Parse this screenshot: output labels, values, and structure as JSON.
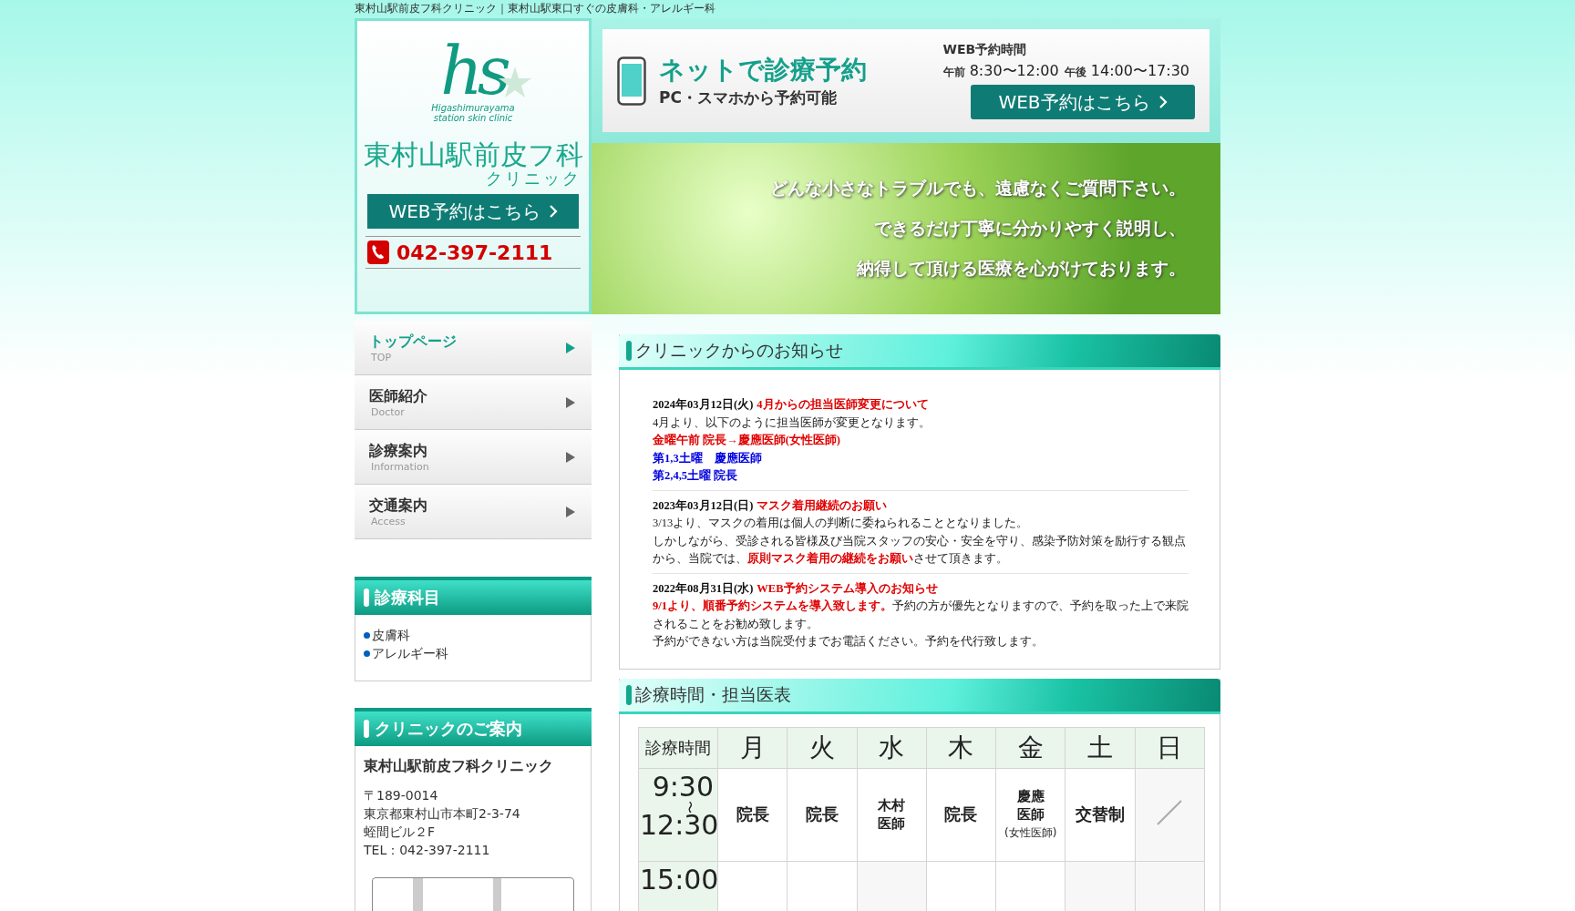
{
  "top_caption": "東村山駅前皮フ科クリニック｜東村山駅東口すぐの皮膚科・アレルギー科",
  "logo": {
    "monogram": "hs",
    "roman_line1": "Higashimurayama",
    "roman_line2": "station skin clinic",
    "name": "東村山駅前皮フ科",
    "name_sub": "クリニック",
    "web_button": "WEB予約はこちら",
    "phone": "042-397-2111"
  },
  "reservation": {
    "headline": "ネットで診療予約",
    "subline": "PC・スマホから予約可能",
    "hours_title": "WEB予約時間",
    "am_label": "午前",
    "am_hours": "8:30〜12:00",
    "pm_label": "午後",
    "pm_hours": "14:00〜17:30",
    "button": "WEB予約はこちら"
  },
  "banner_lines": [
    "どんな小さなトラブルでも、遠慮なくご質問下さい。",
    "できるだけ丁寧に分かりやすく説明し、",
    "納得して頂ける医療を心がけております。"
  ],
  "nav": [
    {
      "label": "トップページ",
      "sub": "TOP",
      "selected": true
    },
    {
      "label": "医師紹介",
      "sub": "Doctor",
      "selected": false
    },
    {
      "label": "診療案内",
      "sub": "Information",
      "selected": false
    },
    {
      "label": "交通案内",
      "sub": "Access",
      "selected": false
    }
  ],
  "departments": {
    "title": "診療科目",
    "items": [
      "皮膚科",
      "アレルギー科"
    ]
  },
  "clinic_info": {
    "title": "クリニックのご案内",
    "name": "東村山駅前皮フ科クリニック",
    "address_lines": [
      "〒189-0014",
      "東京都東村山市本町2-3-74",
      "蛭間ビル２F",
      "TEL：042-397-2111"
    ]
  },
  "news": {
    "title": "クリニックからのお知らせ",
    "items": [
      {
        "date": "2024年03月12日(火)",
        "title": "4月からの担当医師変更について",
        "lines": [
          {
            "kind": "plain",
            "text": "4月より、以下のように担当医師が変更となります。"
          },
          {
            "kind": "red",
            "text": "金曜午前 院長→慶應医師(女性医師)"
          },
          {
            "kind": "blue",
            "text": "第1,3土曜　慶應医師"
          },
          {
            "kind": "blue",
            "text": "第2,4,5土曜 院長"
          }
        ]
      },
      {
        "date": "2023年03月12日(日)",
        "title": "マスク着用継続のお願い",
        "lines": [
          {
            "kind": "plain",
            "text": "3/13より、マスクの着用は個人の判断に委ねられることとなりました。"
          },
          {
            "kind": "plain",
            "text": "しかしながら、受診される皆様及び当院スタッフの安心・安全を守り、感染予防対策を励行する観点から、当院では、**原則マスク着用の継続をお願い**させて頂きます。"
          }
        ]
      },
      {
        "date": "2022年08月31日(水)",
        "title": "WEB予約システム導入のお知らせ",
        "lines": [
          {
            "kind": "plain",
            "text": "**9/1より、順番予約システムを導入致します。**予約の方が優先となりますので、予約を取った上で来院されることをお勧め致します。"
          },
          {
            "kind": "plain",
            "text": "予約ができない方は当院受付までお電話ください。予約を代行致します。"
          }
        ]
      }
    ]
  },
  "schedule": {
    "title": "診療時間・担当医表",
    "corner": "診療時間",
    "days": [
      "月",
      "火",
      "水",
      "木",
      "金",
      "土",
      "日"
    ],
    "rows": [
      {
        "time_start": "9:30",
        "separator": "〜",
        "time_end": "12:30",
        "cells": [
          {
            "kind": "doctor",
            "lines": [
              "院長"
            ]
          },
          {
            "kind": "doctor",
            "lines": [
              "院長"
            ]
          },
          {
            "kind": "small",
            "lines": [
              "木村",
              "医師"
            ]
          },
          {
            "kind": "doctor",
            "lines": [
              "院長"
            ]
          },
          {
            "kind": "small",
            "lines": [
              "慶應",
              "医師",
              "(女性医師)"
            ]
          },
          {
            "kind": "doctor",
            "lines": [
              "交替制"
            ]
          },
          {
            "kind": "closed"
          }
        ]
      },
      {
        "time_start": "15:00",
        "cells": [
          {
            "kind": "blank"
          },
          {
            "kind": "blank"
          },
          {
            "kind": "shaded"
          },
          {
            "kind": "blank"
          },
          {
            "kind": "blank"
          },
          {
            "kind": "shaded"
          },
          {
            "kind": "shaded"
          }
        ]
      }
    ]
  }
}
